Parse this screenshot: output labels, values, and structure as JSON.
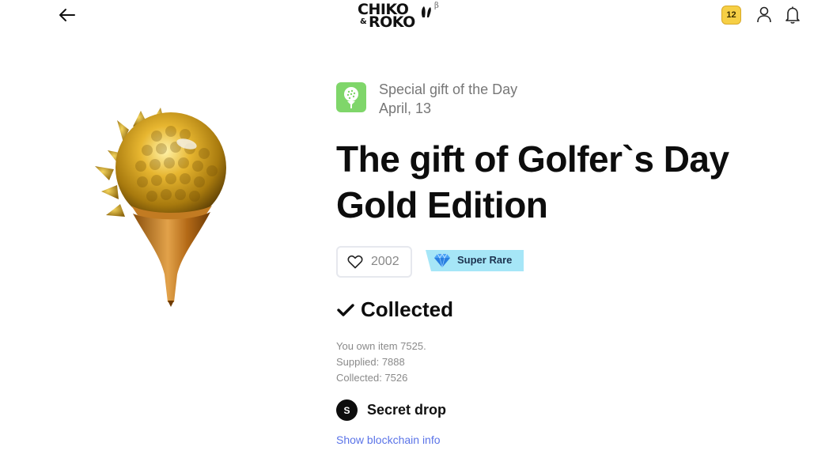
{
  "header": {
    "back_icon": "arrow-left-icon",
    "logo": {
      "line1": "CHIKO",
      "line2": "ROKO",
      "amp": "&",
      "beta": "β"
    },
    "coins": "12",
    "profile_icon": "user-icon",
    "notifications_icon": "bell-icon"
  },
  "item": {
    "image_icon": "golden-golf-ball-on-tee",
    "category_icon": "golf-ball-on-tee-icon",
    "category_color": "#7fd66a",
    "subtitle": "Special gift of the Day",
    "date": "April, 13",
    "title": "The gift of Golfer`s Day Gold Edition",
    "likes": "2002",
    "rarity": "Super Rare",
    "rarity_color": "#a6e6f7",
    "status": "Collected",
    "own_item": "You own item 7525.",
    "supplied": "Supplied: 7888",
    "collected": "Collected: 7526",
    "creator_initial": "S",
    "creator_name": "Secret drop",
    "blockchain_link": "Show blockchain info",
    "link_color": "#5b74e8"
  }
}
